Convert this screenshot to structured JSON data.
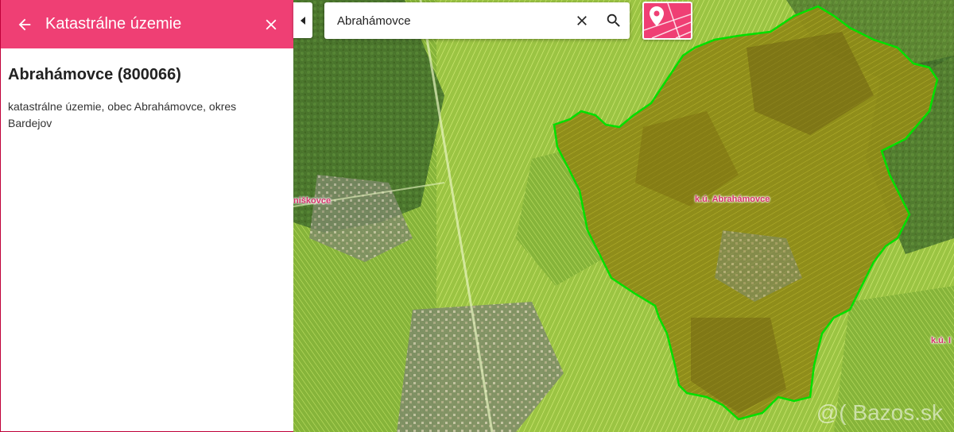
{
  "panel": {
    "title": "Katastrálne územie",
    "area_name": "Abrahámovce (800066)",
    "area_description": "katastrálne územie, obec Abrahámovce, okres Bardejov"
  },
  "search": {
    "value": "Abrahámovce"
  },
  "map": {
    "labels": {
      "selected_area": "k.ú. Abrahámovce",
      "west_area": "niškovce",
      "east_area": "k.ú. I"
    },
    "highlight_color": "#00e000",
    "fill_color": "#8a7a10"
  },
  "watermark": "@( Bazos.sk",
  "colors": {
    "accent": "#ef3f74"
  }
}
